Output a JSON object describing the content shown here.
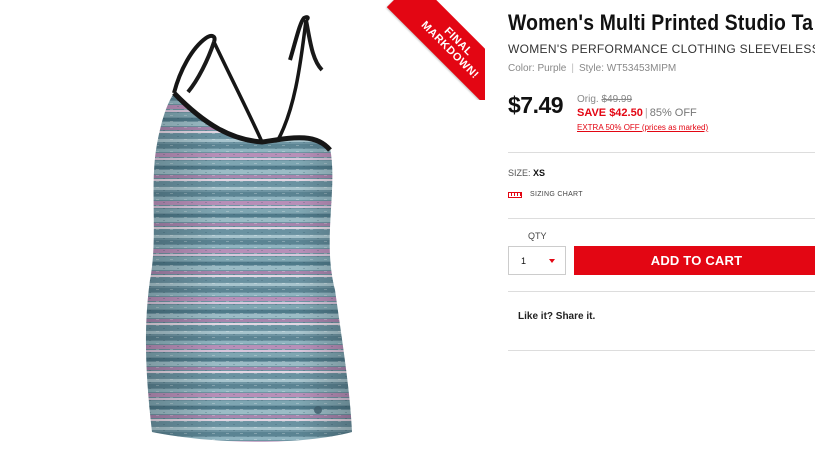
{
  "product": {
    "title": "Women's Multi Printed Studio Ta",
    "category": "WOMEN'S PERFORMANCE CLOTHING SLEEVELESS",
    "color_label": "Color: Purple",
    "style_label": "Style: WT53453MIPM",
    "image_alt": "Women's Multi Printed Studio Tank - Purple"
  },
  "badge": {
    "line1": "FINAL",
    "line2": "MARKDOWN!"
  },
  "pricing": {
    "price": "$7.49",
    "orig_label": "Orig.",
    "orig_price": "$49.99",
    "save_text": "SAVE $42.50",
    "percent_off": "85% OFF",
    "extra_offer": "EXTRA 50% OFF (prices as marked)"
  },
  "size": {
    "label": "SIZE:",
    "value": "XS",
    "chart_link": "SIZING CHART",
    "chart_icon": "ruler-icon"
  },
  "purchase": {
    "qty_label": "QTY",
    "qty_value": "1",
    "qty_icon": "caret-down-icon",
    "add_to_cart": "ADD TO CART"
  },
  "share": {
    "label": "Like it? Share it."
  },
  "colors": {
    "accent": "#e30613",
    "text": "#111111",
    "muted": "#888888",
    "divider": "#dddddd"
  }
}
